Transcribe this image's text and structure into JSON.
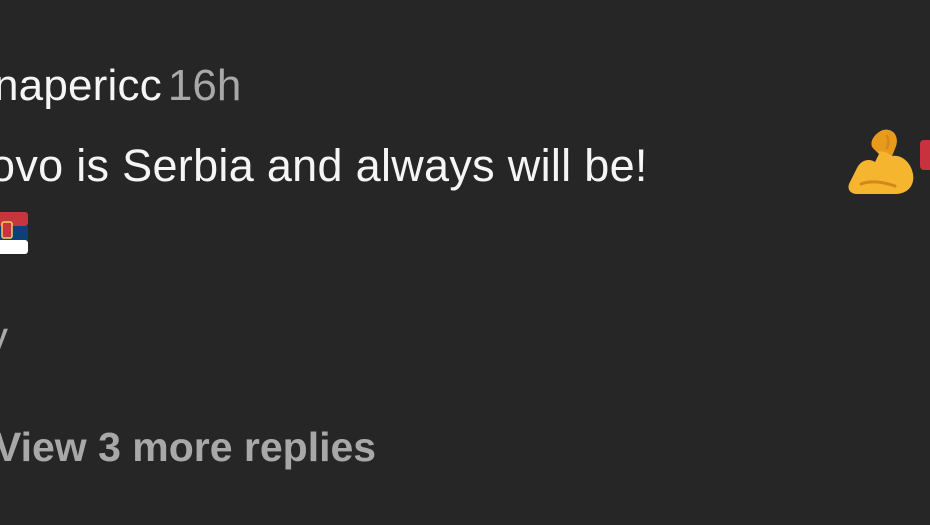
{
  "comment": {
    "username": "napericc",
    "timestamp": "16h",
    "text": "ovo is Serbia and always will be!",
    "emojis": [
      "flexed-biceps-icon",
      "serbia-flag-icon"
    ],
    "reply_button_label": "y"
  },
  "replies": {
    "view_more_label": "View 3 more replies"
  },
  "colors": {
    "background": "#262626",
    "primary_text": "#f5f5f5",
    "secondary_text": "#a8a8a8",
    "flag_red": "#c6363c",
    "flag_blue": "#0c4076",
    "flag_white": "#ffffff",
    "emoji_yellow": "#f5b52e"
  }
}
